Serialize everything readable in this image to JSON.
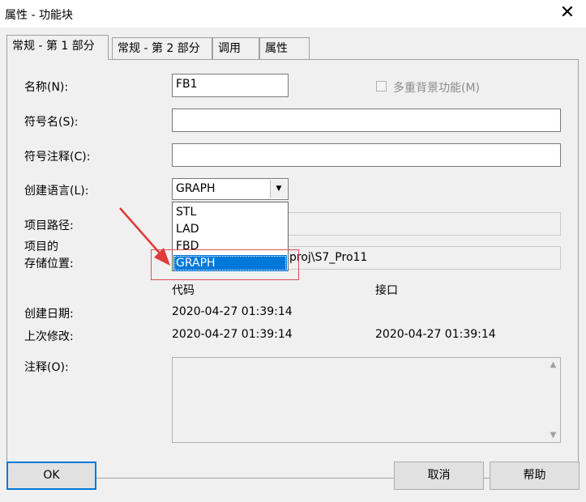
{
  "window": {
    "title": "属性 - 功能块",
    "close_glyph": "✕"
  },
  "tabs": [
    {
      "label": "常规 - 第 1 部分"
    },
    {
      "label": "常规 - 第 2 部分"
    },
    {
      "label": "调用"
    },
    {
      "label": "属性"
    }
  ],
  "form": {
    "name_label": "名称(N):",
    "name_value": "FB1",
    "multi_instance_label": "多重背景功能(M)",
    "symbol_name_label": "符号名(S):",
    "symbol_name_value": "",
    "symbol_comment_label": "符号注释(C):",
    "symbol_comment_value": "",
    "language_label": "创建语言(L):",
    "language_value": "GRAPH",
    "language_options": [
      "STL",
      "LAD",
      "FBD",
      "GRAPH"
    ],
    "project_path_label": "项目路径:",
    "storage_label_line1": "项目的",
    "storage_label_line2": "存储位置:",
    "storage_value_visible": "proj\\S7_Pro11",
    "code_header": "代码",
    "interface_header": "接口",
    "created_label": "创建日期:",
    "created_code": "2020-04-27 01:39:14",
    "modified_label": "上次修改:",
    "modified_code": "2020-04-27 01:39:14",
    "modified_interface": "2020-04-27 01:39:14",
    "comment_label": "注释(O):"
  },
  "buttons": {
    "ok": "OK",
    "cancel": "取消",
    "help": "帮助"
  },
  "colors": {
    "selection": "#0078d7",
    "annotation": "#e05050"
  }
}
